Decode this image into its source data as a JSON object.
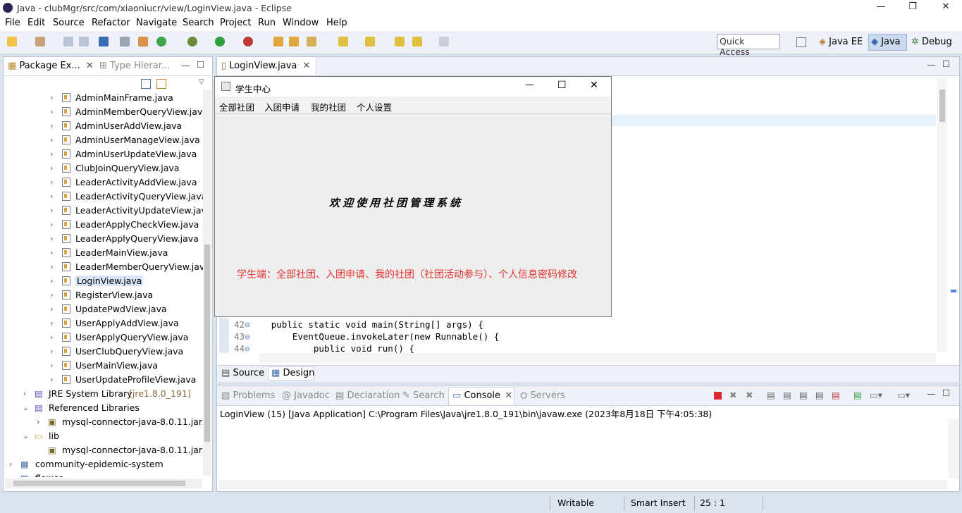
{
  "window": {
    "title": "Java - clubMgr/src/com/xiaoniucr/view/LoginView.java - Eclipse",
    "min": "—",
    "max": "❐",
    "close": "✕"
  },
  "menu": [
    "File",
    "Edit",
    "Source",
    "Refactor",
    "Navigate",
    "Search",
    "Project",
    "Run",
    "Window",
    "Help"
  ],
  "quick_access": "Quick Access",
  "perspectives": {
    "javaee": "Java EE",
    "java": "Java",
    "debug": "Debug"
  },
  "package_explorer": {
    "tab1": "Package Ex...",
    "tab2": "Type Hierar...",
    "items": [
      "AdminMainFrame.java",
      "AdminMemberQueryView.java",
      "AdminUserAddView.java",
      "AdminUserManageView.java",
      "AdminUserUpdateView.java",
      "ClubJoinQueryView.java",
      "LeaderActivityAddView.java",
      "LeaderActivityQueryView.java",
      "LeaderActivityUpdateView.java",
      "LeaderApplyCheckView.java",
      "LeaderApplyQueryView.java",
      "LeaderMainView.java",
      "LeaderMemberQueryView.java",
      "LoginView.java",
      "RegisterView.java",
      "UpdatePwdView.java",
      "UserApplyAddView.java",
      "UserApplyQueryView.java",
      "UserClubQueryView.java",
      "UserMainView.java",
      "UserUpdateProfileView.java"
    ],
    "jre": "JRE System Library",
    "jre_version": "[jre1.8.0_191]",
    "ref_libs": "Referenced Libraries",
    "jar1": "mysql-connector-java-8.0.11.jar",
    "lib": "lib",
    "jar2": "mysql-connector-java-8.0.11.jar",
    "project2": "community-epidemic-system",
    "project3": "flower"
  },
  "editor": {
    "tab": "LoginView.java",
    "lines": [
      {
        "num": "42",
        "code": "public static void main(String[] args) {"
      },
      {
        "num": "43",
        "code": "    EventQueue.invokeLater(new Runnable() {"
      },
      {
        "num": "44",
        "code": "        public void run() {"
      }
    ],
    "source_tab": "Source",
    "design_tab": "Design"
  },
  "swing_window": {
    "title": "学生中心",
    "menu": [
      "全部社团",
      "入团申请",
      "我的社团",
      "个人设置"
    ],
    "welcome": "欢迎使用社团管理系统",
    "annotation": "学生端：全部社团、入团申请、我的社团（社团活动参与）、个人信息密码修改",
    "annotation_color": "#e8332e"
  },
  "console": {
    "tabs": [
      "Problems",
      "Javadoc",
      "Declaration",
      "Search",
      "Console",
      "Servers"
    ],
    "launch": "LoginView (15) [Java Application] C:\\Program Files\\Java\\jre1.8.0_191\\bin\\javaw.exe (2023年8月18日 下午4:05:38)"
  },
  "status": {
    "writable": "Writable",
    "insert": "Smart Insert",
    "pos": "25 : 1"
  }
}
